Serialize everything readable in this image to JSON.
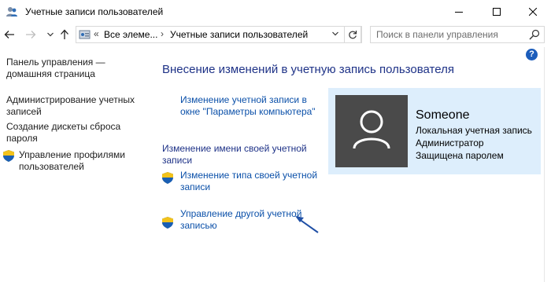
{
  "window": {
    "title": "Учетные записи пользователей"
  },
  "navigation": {
    "breadcrumb": [
      "Все элеме...",
      "Учетные записи пользователей"
    ],
    "search_placeholder": "Поиск в панели управления"
  },
  "sidebar": {
    "items": [
      {
        "label_lines": [
          "Панель управления —",
          "домашняя страница"
        ],
        "shield": false
      },
      {
        "label_lines": [
          "Администрирование учетных",
          "записей"
        ],
        "shield": false
      },
      {
        "label_lines": [
          "Создание дискеты сброса",
          "пароля"
        ],
        "shield": false
      },
      {
        "label_lines": [
          "Управление профилями",
          "пользователей"
        ],
        "shield": true
      }
    ]
  },
  "main": {
    "title": "Внесение изменений в учетную запись пользователя",
    "tasks": [
      {
        "label_lines": [
          "Изменение учетной записи в",
          "окне \"Параметры компьютера\""
        ],
        "shield": false
      },
      {
        "label_lines": [
          "Изменение имени своей учетной",
          "записи"
        ],
        "shield": false
      },
      {
        "label_lines": [
          "Изменение типа своей учетной",
          "записи"
        ],
        "shield": true
      },
      {
        "label_lines": [
          "Управление другой учетной",
          "записью"
        ],
        "shield": true
      }
    ]
  },
  "user": {
    "name": "Someone",
    "details": [
      "Локальная учетная запись",
      "Администратор",
      "Защищена паролем"
    ]
  },
  "help_label": "?",
  "colors": {
    "link": "#0b50a9",
    "title": "#1e3287",
    "user_panel": "#ddeefc",
    "avatar_bg": "#4a4a4a",
    "arrow": "#1f4fa5"
  }
}
